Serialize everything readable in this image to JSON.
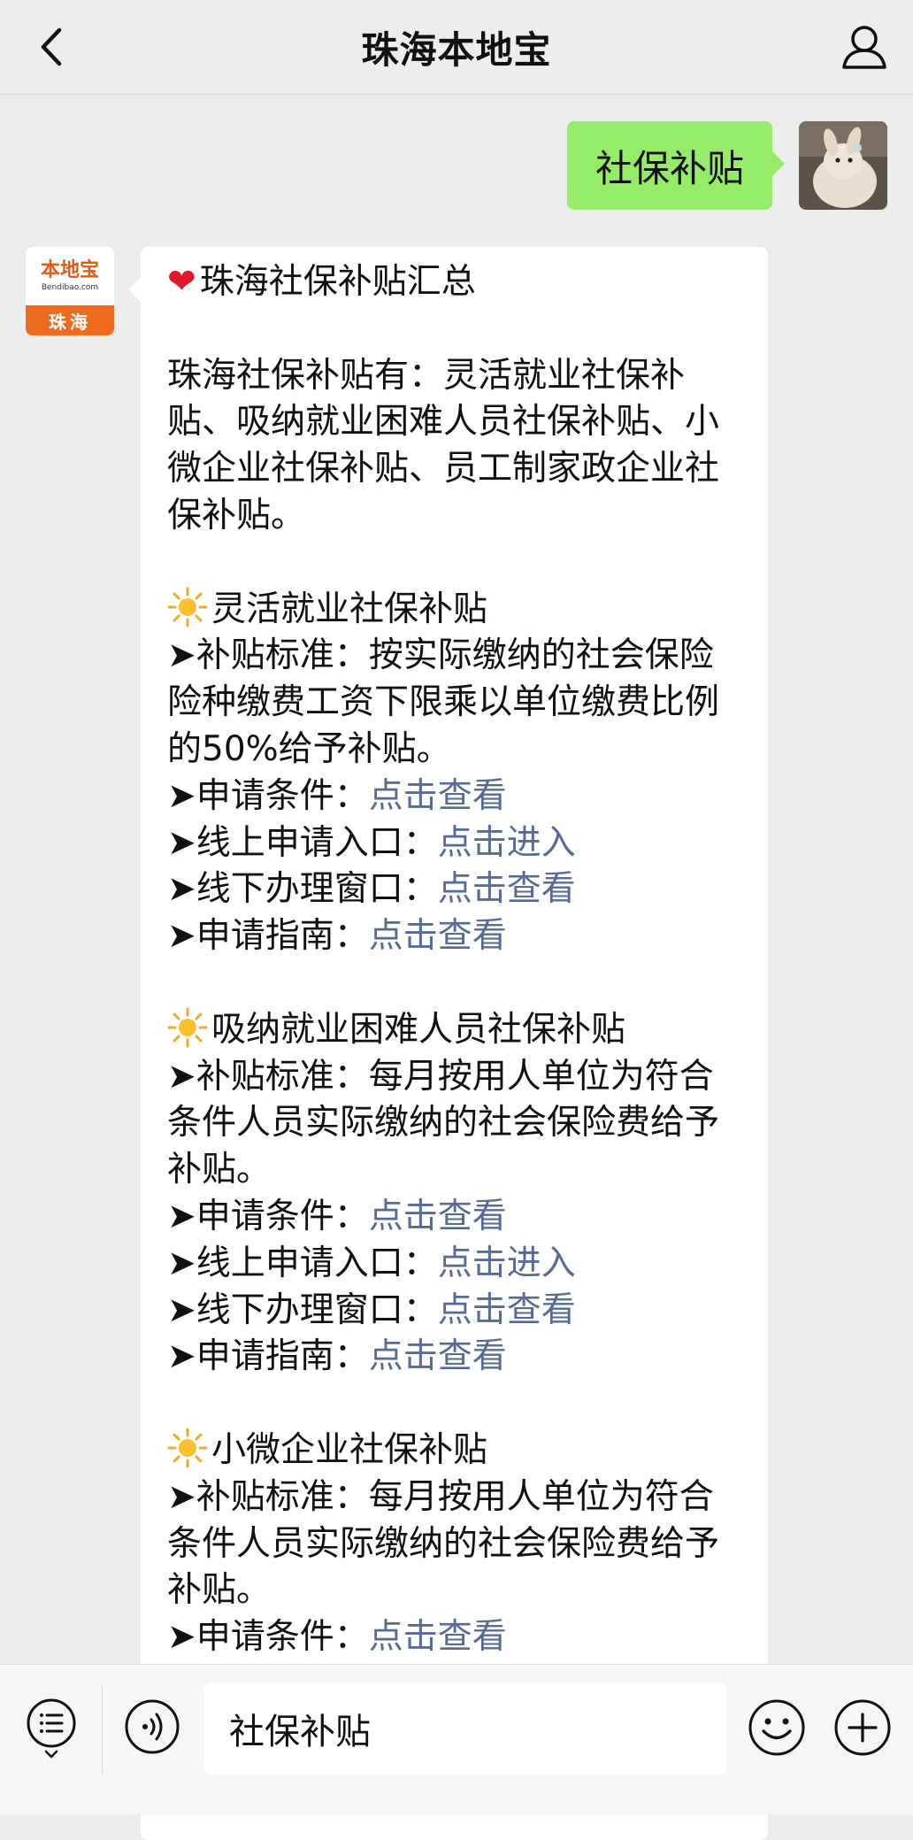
{
  "header": {
    "title": "珠海本地宝",
    "back_icon": "chevron-left-icon",
    "profile_icon": "person-icon"
  },
  "user_message": {
    "text": "社保补贴"
  },
  "bot": {
    "avatar": {
      "logo_text": "本地宝",
      "domain": "Bendibao.com",
      "city": "珠海"
    },
    "title": "珠海社保补贴汇总",
    "intro": "珠海社保补贴有：灵活就业社保补贴、吸纳就业困难人员社保补贴、小微企业社保补贴、员工制家政企业社保补贴。",
    "arrow": "➤",
    "sections": [
      {
        "heading": "灵活就业社保补贴",
        "standard": "补贴标准：按实际缴纳的社会保险险种缴费工资下限乘以单位缴费比例的50%给予补贴。",
        "items": [
          {
            "label": "申请条件：",
            "link": "点击查看"
          },
          {
            "label": "线上申请入口：",
            "link": "点击进入"
          },
          {
            "label": "线下办理窗口：",
            "link": "点击查看"
          },
          {
            "label": "申请指南：",
            "link": "点击查看"
          }
        ]
      },
      {
        "heading": "吸纳就业困难人员社保补贴",
        "standard": "补贴标准：每月按用人单位为符合条件人员实际缴纳的社会保险费给予补贴。",
        "items": [
          {
            "label": "申请条件：",
            "link": "点击查看"
          },
          {
            "label": "线上申请入口：",
            "link": "点击进入"
          },
          {
            "label": "线下办理窗口：",
            "link": "点击查看"
          },
          {
            "label": "申请指南：",
            "link": "点击查看"
          }
        ]
      },
      {
        "heading": "小微企业社保补贴",
        "standard": "补贴标准：每月按用人单位为符合条件人员实际缴纳的社会保险费给予补贴。",
        "items": [
          {
            "label": "申请条件：",
            "link": "点击查看"
          }
        ]
      }
    ]
  },
  "input_bar": {
    "value": "社保补贴",
    "menu_icon": "menu-list-icon",
    "voice_icon": "voice-icon",
    "emoji_icon": "emoji-icon",
    "plus_icon": "plus-icon"
  },
  "colors": {
    "user_bubble": "#95ec69",
    "link": "#576b95",
    "brand_orange": "#ee6a1c"
  }
}
